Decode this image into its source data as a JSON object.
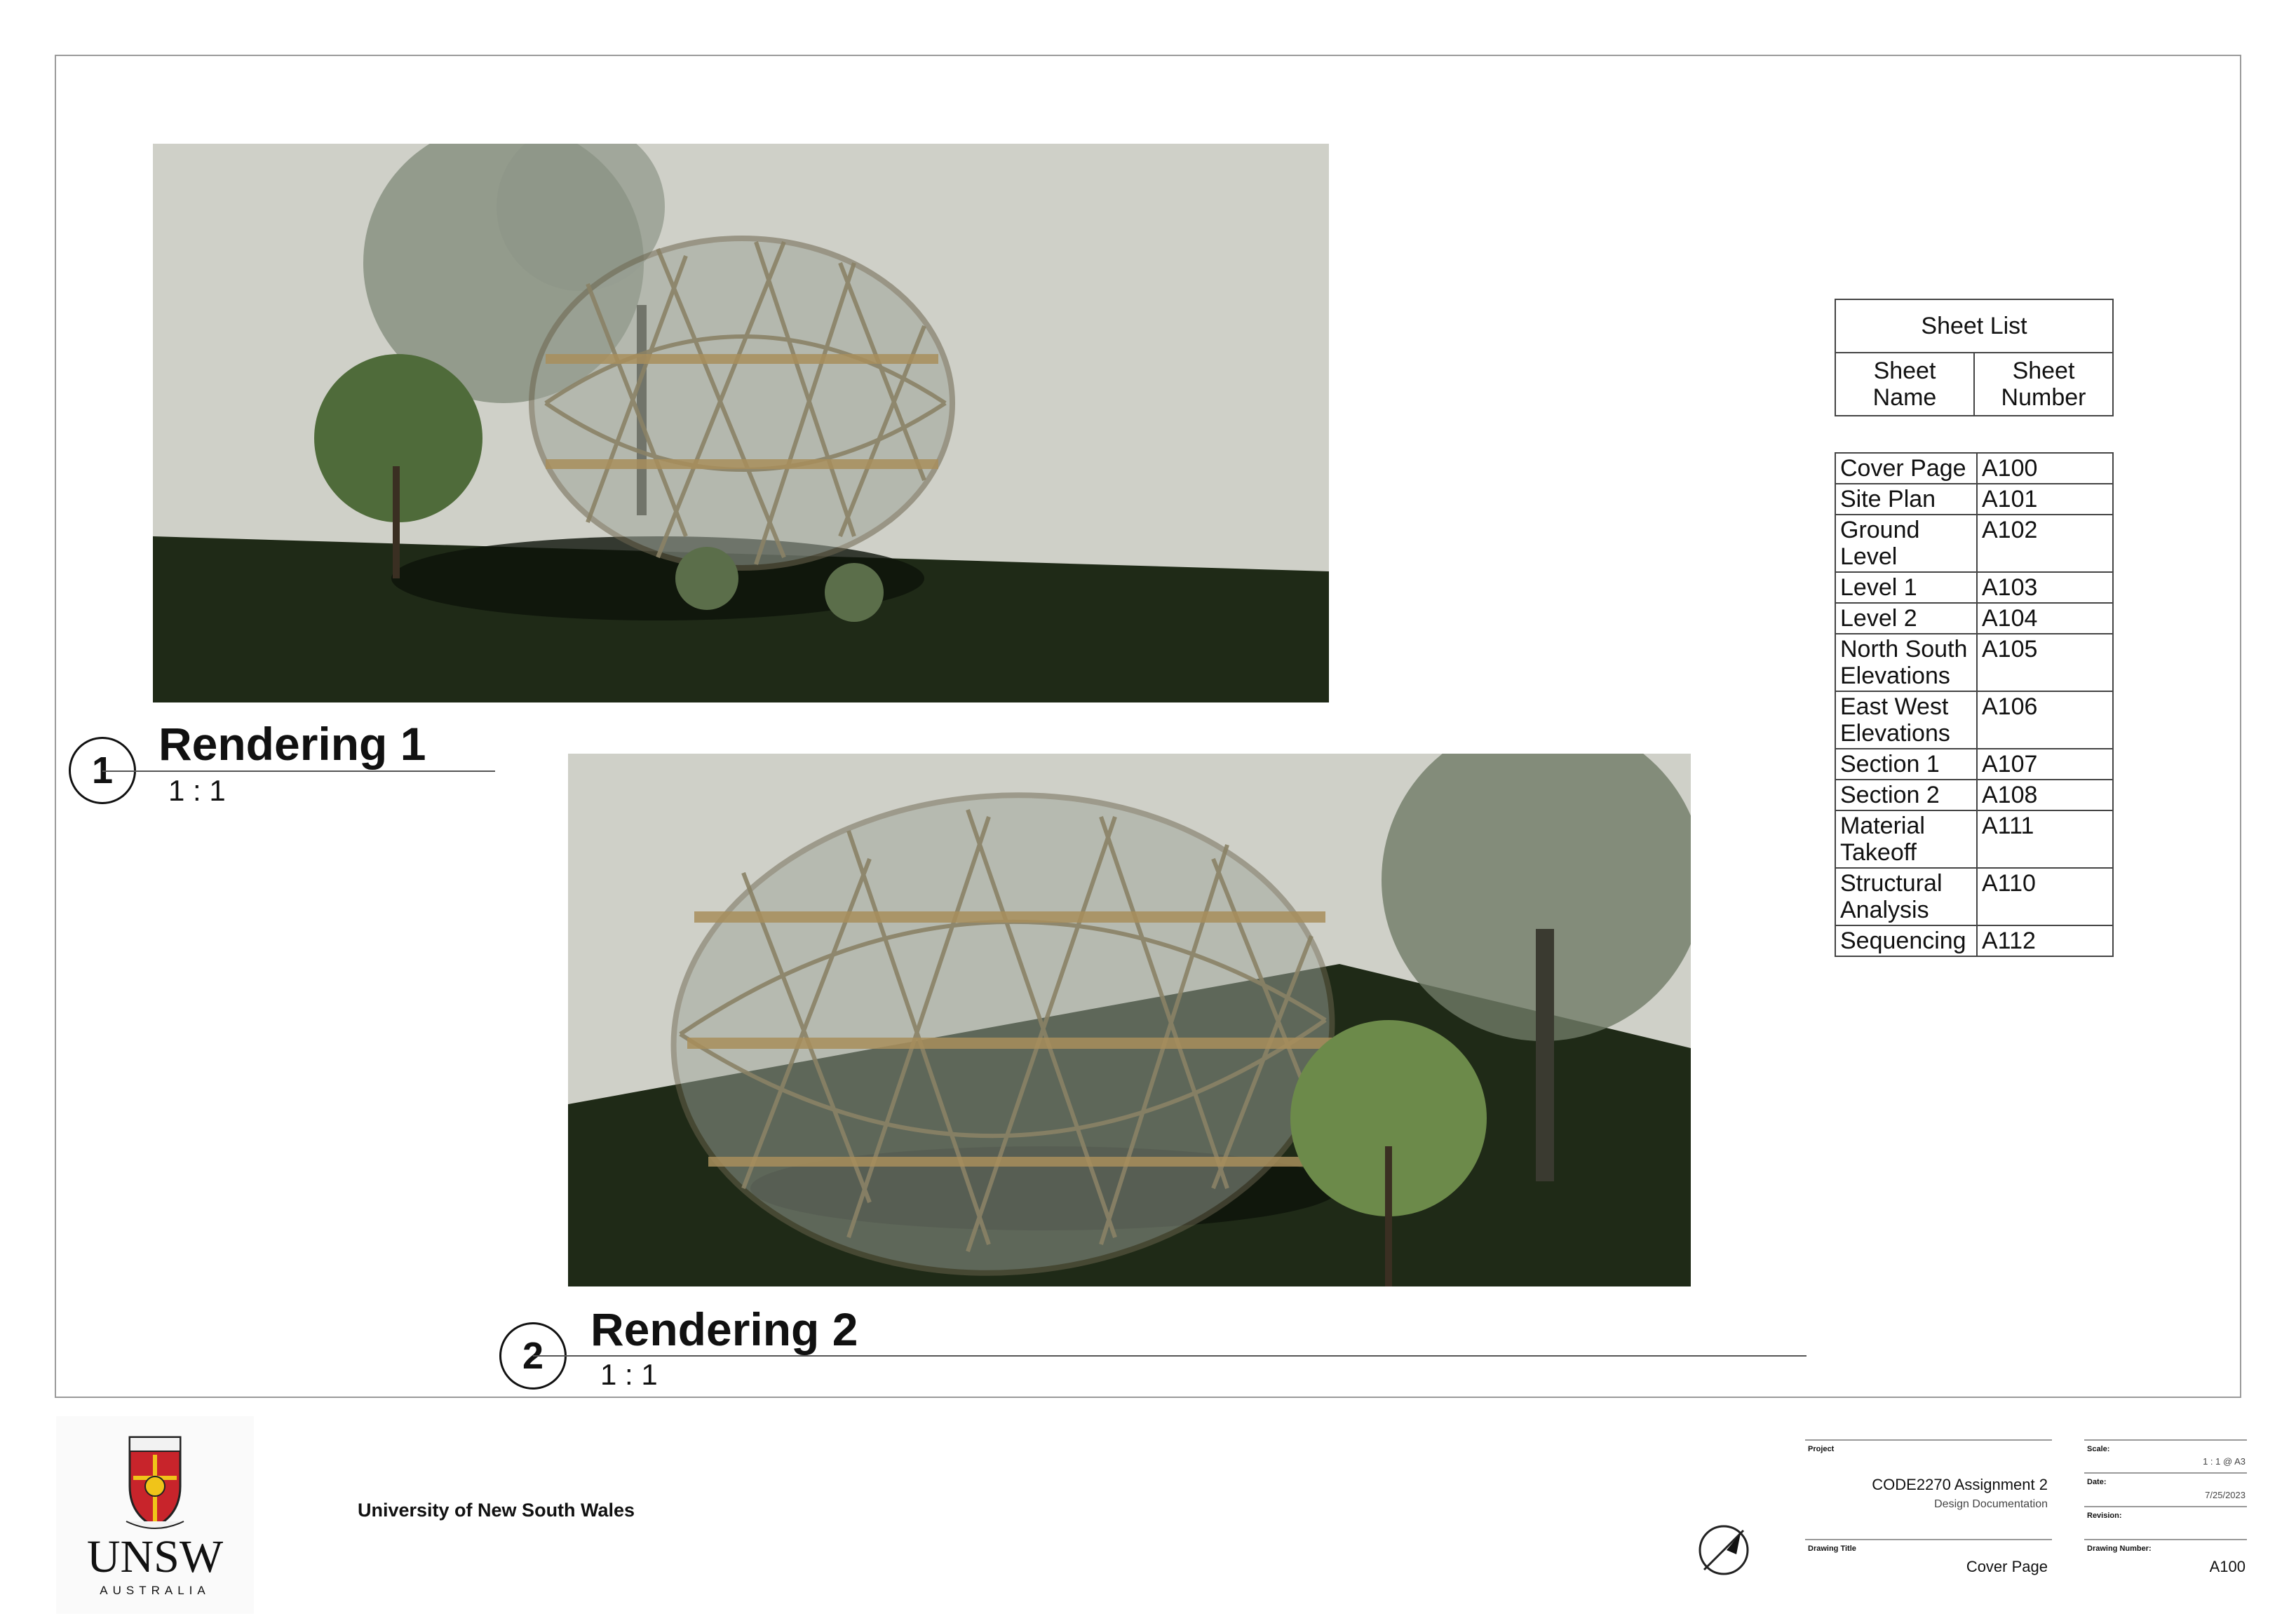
{
  "views": [
    {
      "number": "1",
      "title": "Rendering 1",
      "scale": "1 : 1"
    },
    {
      "number": "2",
      "title": "Rendering 2",
      "scale": "1 : 1"
    }
  ],
  "sheet_list": {
    "title": "Sheet List",
    "col_name": "Sheet Name",
    "col_number": "Sheet Number",
    "rows": [
      {
        "name": "Cover Page",
        "number": "A100"
      },
      {
        "name": "Site Plan",
        "number": "A101"
      },
      {
        "name": "Ground Level",
        "number": "A102"
      },
      {
        "name": "Level 1",
        "number": "A103"
      },
      {
        "name": "Level 2",
        "number": "A104"
      },
      {
        "name": "North South Elevations",
        "number": "A105"
      },
      {
        "name": "East West Elevations",
        "number": "A106"
      },
      {
        "name": "Section 1",
        "number": "A107"
      },
      {
        "name": "Section 2",
        "number": "A108"
      },
      {
        "name": "Material Takeoff",
        "number": "A111"
      },
      {
        "name": "Structural Analysis",
        "number": "A110"
      },
      {
        "name": "Sequencing",
        "number": "A112"
      }
    ]
  },
  "title_block": {
    "logo_text": "UNSW",
    "logo_subtext": "AUSTRALIA",
    "university": "University of New South Wales",
    "project_label": "Project",
    "project_name": "CODE2270 Assignment 2",
    "project_sub": "Design Documentation",
    "drawing_title_label": "Drawing Title",
    "drawing_title": "Cover Page",
    "scale_label": "Scale:",
    "scale_value": "1 : 1 @ A3",
    "date_label": "Date:",
    "date_value": "7/25/2023",
    "revision_label": "Revision:",
    "drawing_number_label": "Drawing Number:",
    "drawing_number": "A100"
  }
}
